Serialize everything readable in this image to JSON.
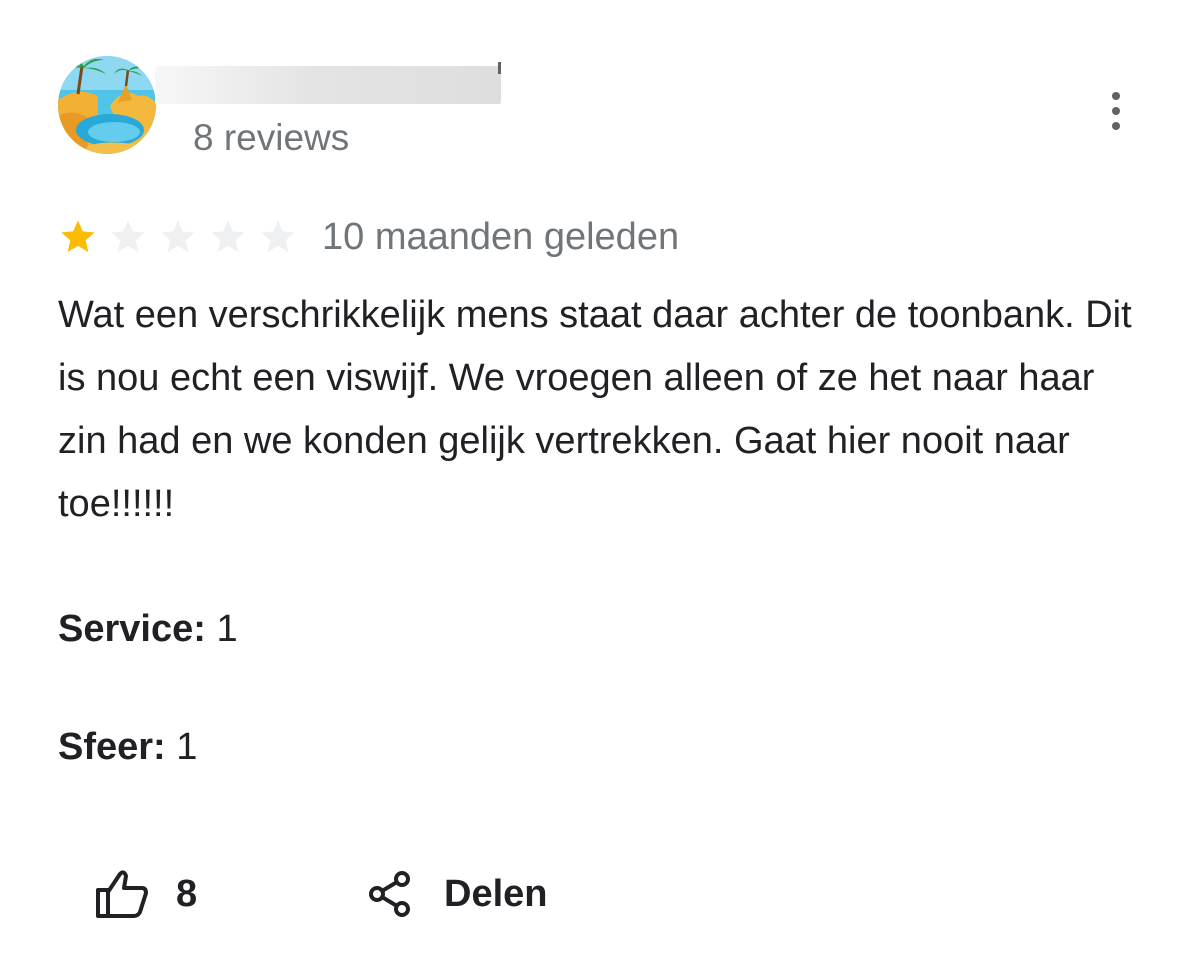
{
  "reviewer": {
    "reviews_count_text": "8 reviews",
    "avatar_icon": "beach-palm-avatar-icon"
  },
  "review": {
    "rating": 1,
    "max_rating": 5,
    "star_colors": {
      "filled": "#fbbc04",
      "empty": "#eef0f1"
    },
    "date": "10 maanden geleden",
    "text": "Wat een verschrikkelijk mens staat daar achter de toonbank. Dit is nou echt een viswijf. We vroegen alleen of ze het naar haar zin had en we konden gelijk vertrekken. Gaat hier nooit naar toe!!!!!!",
    "attributes": [
      {
        "label": "Service:",
        "value": " 1"
      },
      {
        "label": "Sfeer:",
        "value": " 1"
      }
    ]
  },
  "actions": {
    "like_count": "8",
    "share_label": "Delen",
    "like_icon": "thumbs-up-icon",
    "share_icon": "share-icon",
    "menu_icon": "more-vertical-icon"
  }
}
